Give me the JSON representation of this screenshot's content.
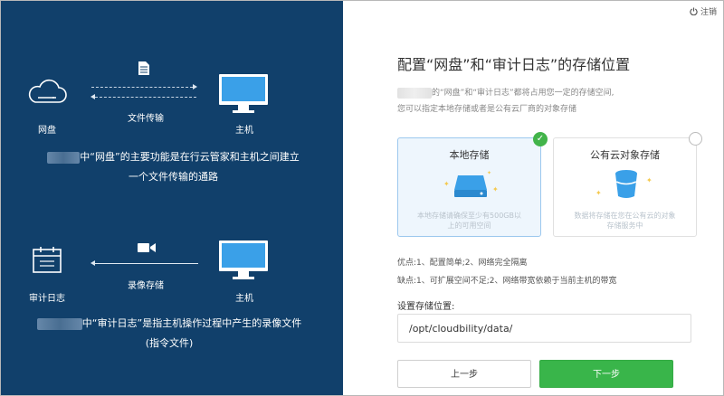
{
  "logout": {
    "label": "注销"
  },
  "left": {
    "netdisk_label": "网盘",
    "host_label_1": "主机",
    "file_transfer_label": "文件传输",
    "desc1_line1": "中“网盘”的主要功能是在行云管家和主机之间建立",
    "desc1_line2": "一个文件传输的通路",
    "audit_label": "审计日志",
    "host_label_2": "主机",
    "video_label": "录像存储",
    "desc2_line1": "中“审计日志”是指主机操作过程中产生的录像文件",
    "desc2_line2": "(指令文件)"
  },
  "right": {
    "title": "配置“网盘”和“审计日志”的存储位置",
    "sub1": "的“网盘”和“审计日志”都将占用您一定的存储空间,",
    "sub2": "您可以指定本地存储或者是公有云厂商的对象存储",
    "local_card": {
      "title": "本地存储",
      "desc_line1": "本地存储请确保至少有500GB以",
      "desc_line2": "上的可用空间"
    },
    "cloud_card": {
      "title": "公有云对象存储",
      "desc_line1": "数据将存储在您在公有云的对象",
      "desc_line2": "存储服务中"
    },
    "pros": "优点:1、配置简单;2、网络完全隔离",
    "cons": "缺点:1、可扩展空间不足;2、网络带宽依赖于当前主机的带宽",
    "field_label": "设置存储位置:",
    "path_value": "/opt/cloudbility/data/",
    "prev_button": "上一步",
    "next_button": "下一步"
  },
  "colors": {
    "left_bg": "#11406b",
    "accent_blue": "#3aa0e8",
    "green": "#39b54a"
  }
}
